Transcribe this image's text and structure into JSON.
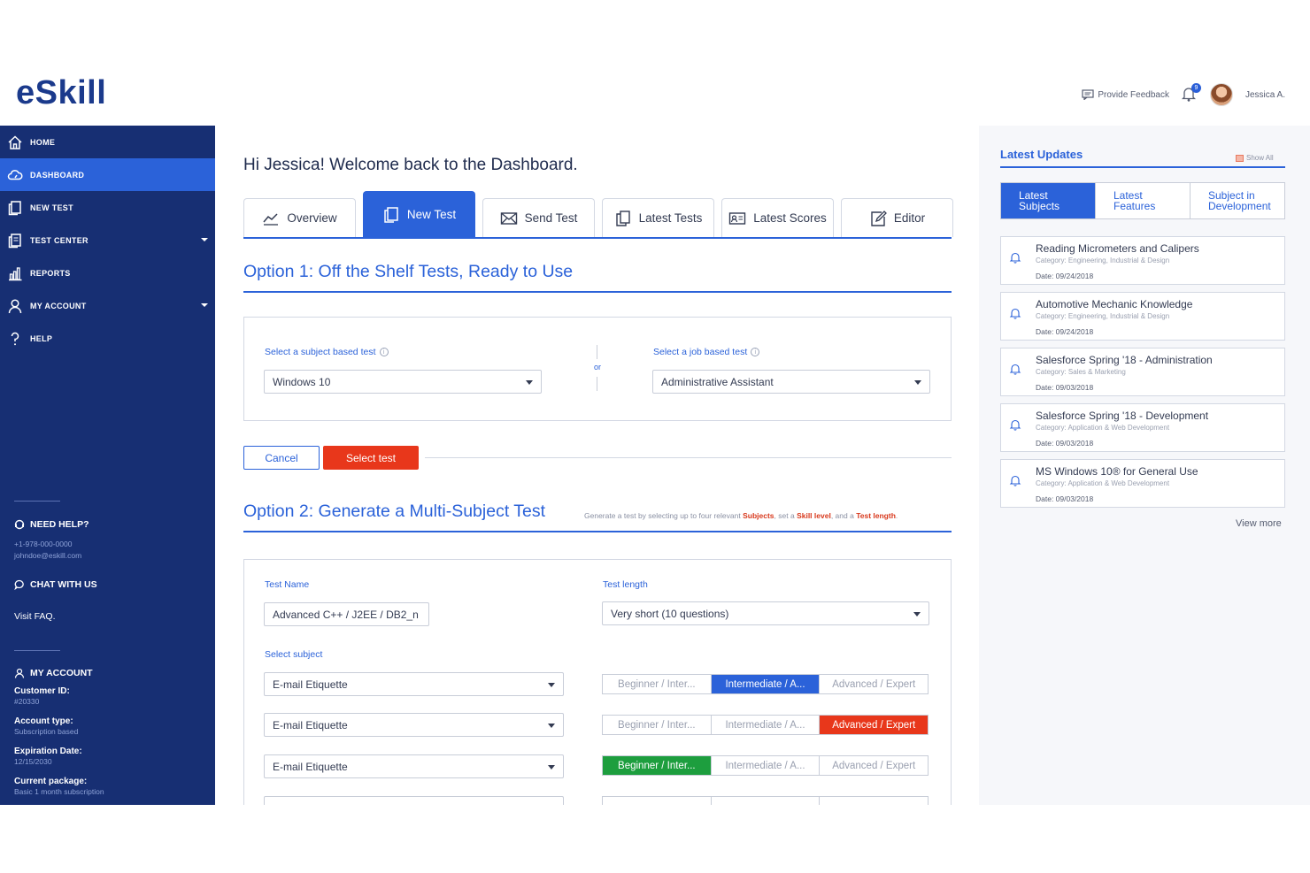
{
  "app": {
    "logo": "eSkill"
  },
  "header": {
    "feedback_label": "Provide Feedback",
    "notification_count": "9",
    "user_name": "Jessica A."
  },
  "sidebar": {
    "nav": [
      {
        "label": "HOME",
        "icon": "home-icon"
      },
      {
        "label": "DASHBOARD",
        "icon": "cloud-icon",
        "active": true
      },
      {
        "label": "NEW TEST",
        "icon": "new-test-icon"
      },
      {
        "label": "TEST CENTER",
        "icon": "test-center-icon",
        "has_submenu": true
      },
      {
        "label": "REPORTS",
        "icon": "bar-chart-icon"
      },
      {
        "label": "MY ACCOUNT",
        "icon": "user-icon",
        "has_submenu": true
      },
      {
        "label": "HELP",
        "icon": "question-icon"
      }
    ],
    "need_help": {
      "title": "NEED HELP?",
      "phone": "+1-978-000-0000",
      "email": "johndoe@eskill.com"
    },
    "chat_label": "CHAT WITH US",
    "faq_label": "Visit FAQ.",
    "account": {
      "title": "MY ACCOUNT",
      "customer_id_label": "Customer ID:",
      "customer_id": "#20330",
      "account_type_label": "Account type:",
      "account_type": "Subscription based",
      "expiration_label": "Expiration Date:",
      "expiration": "12/15/2030",
      "package_label": "Current package:",
      "package": "Basic 1 month subscription"
    }
  },
  "main": {
    "welcome": "Hi Jessica! Welcome back to the Dashboard.",
    "tabs": [
      {
        "label": "Overview",
        "icon": "trend-line-icon"
      },
      {
        "label": "New Test",
        "icon": "new-test-icon",
        "active": true
      },
      {
        "label": "Send Test",
        "icon": "envelope-icon"
      },
      {
        "label": "Latest Tests",
        "icon": "documents-icon"
      },
      {
        "label": "Latest Scores",
        "icon": "id-card-icon"
      },
      {
        "label": "Editor",
        "icon": "edit-icon"
      }
    ],
    "option1": {
      "title": "Option 1: Off the Shelf Tests, Ready to Use",
      "subject_label": "Select a subject based test",
      "subject_value": "Windows 10",
      "or_label": "or",
      "job_label": "Select a job based test",
      "job_value": "Administrative Assistant",
      "cancel_label": "Cancel",
      "select_label": "Select test"
    },
    "option2": {
      "title": "Option 2: Generate a Multi-Subject Test",
      "hint_prefix": "Generate a test by selecting up to four relevant",
      "hint_subjects": "Subjects",
      "hint_mid": ", set a",
      "hint_skill": "Skill level",
      "hint_and": ", and a",
      "hint_length": "Test length",
      "hint_end": ".",
      "test_name_label": "Test Name",
      "test_name_value": "Advanced C++ / J2EE / DB2_n",
      "test_length_label": "Test length",
      "test_length_value": "Very short (10 questions)",
      "select_subject_label": "Select subject",
      "levels": [
        "Beginner / Inter...",
        "Intermediate / A...",
        "Advanced / Expert"
      ],
      "rows": [
        {
          "subject": "E-mail Etiquette",
          "selected_level": "Intermediate / A...",
          "color": "#2b62d9"
        },
        {
          "subject": "E-mail Etiquette",
          "selected_level": "Advanced / Expert",
          "color": "#e8371b"
        },
        {
          "subject": "E-mail Etiquette",
          "selected_level": "Beginner / Inter...",
          "color": "#1d9e3e"
        }
      ]
    }
  },
  "updates": {
    "title": "Latest Updates",
    "show_all": "Show All",
    "tabs": [
      {
        "line1": "Latest",
        "line2": "Subjects",
        "active": true
      },
      {
        "line1": "Latest",
        "line2": "Features"
      },
      {
        "line1": "Subject in",
        "line2": "Development"
      }
    ],
    "items": [
      {
        "title": "Reading Micrometers and Calipers",
        "category": "Category: Engineering, Industrial & Design",
        "date": "Date: 09/24/2018"
      },
      {
        "title": "Automotive Mechanic Knowledge",
        "category": "Category: Engineering, Industrial & Design",
        "date": "Date: 09/24/2018"
      },
      {
        "title": "Salesforce Spring '18 - Administration",
        "category": "Category: Sales & Marketing",
        "date": "Date: 09/03/2018"
      },
      {
        "title": "Salesforce Spring '18 - Development",
        "category": "Category: Application & Web Development",
        "date": "Date: 09/03/2018"
      },
      {
        "title": "MS Windows 10® for General Use",
        "category": "Category: Application & Web Development",
        "date": "Date: 09/03/2018"
      }
    ],
    "view_more": "View more"
  },
  "colors": {
    "brand_navy": "#172f73",
    "accent_blue": "#2b62d9",
    "danger_red": "#e8371b",
    "success_green": "#1d9e3e"
  }
}
